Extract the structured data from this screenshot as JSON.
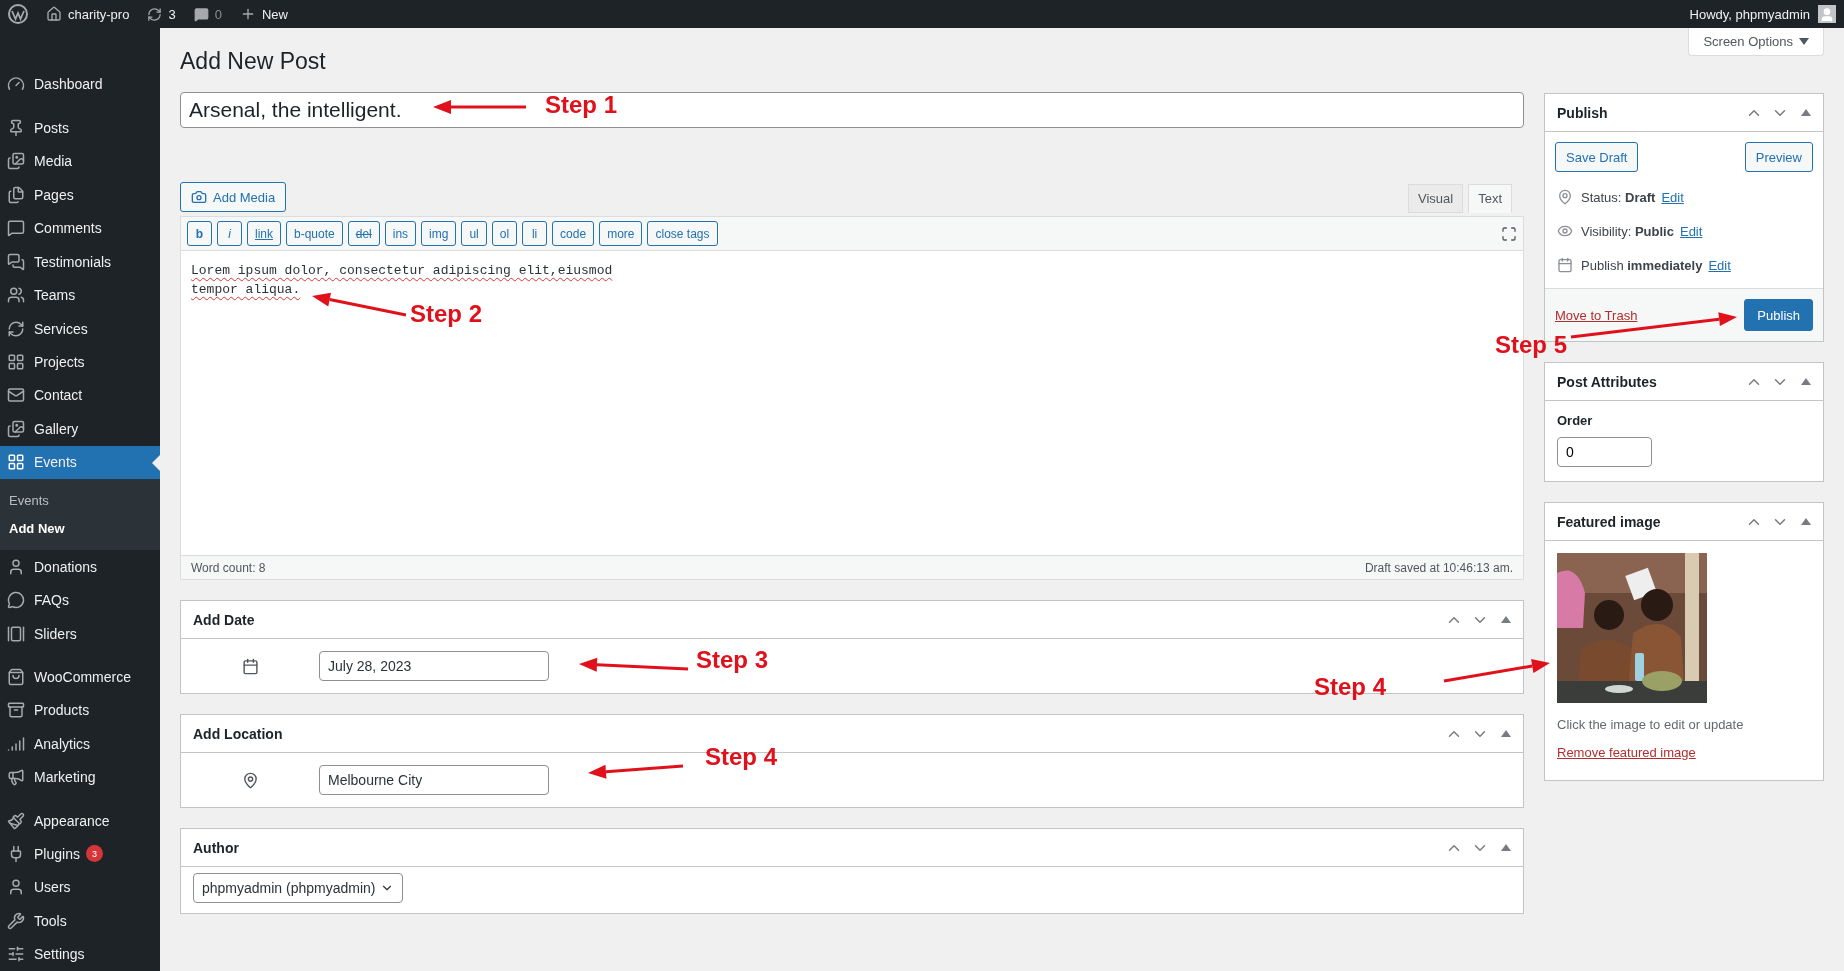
{
  "admin_bar": {
    "site": "charity-pro",
    "updates": "3",
    "comments": "0",
    "new": "New",
    "greeting": "Howdy, phpmyadmin"
  },
  "sidebar": {
    "groups": [
      [
        {
          "label": "Dashboard",
          "selected": false
        }
      ],
      [
        {
          "label": "Posts",
          "selected": false
        },
        {
          "label": "Media",
          "selected": false
        },
        {
          "label": "Pages",
          "selected": false
        },
        {
          "label": "Comments",
          "selected": false
        },
        {
          "label": "Testimonials",
          "selected": false
        },
        {
          "label": "Teams",
          "selected": false
        },
        {
          "label": "Services",
          "selected": false
        },
        {
          "label": "Projects",
          "selected": false
        },
        {
          "label": "Contact",
          "selected": false
        },
        {
          "label": "Gallery",
          "selected": false
        },
        {
          "label": "Events",
          "selected": true,
          "children": [
            {
              "label": "Events",
              "selected": false
            },
            {
              "label": "Add New",
              "selected": true
            }
          ]
        },
        {
          "label": "Donations",
          "selected": false
        },
        {
          "label": "FAQs",
          "selected": false
        },
        {
          "label": "Sliders",
          "selected": false
        }
      ],
      [
        {
          "label": "WooCommerce",
          "selected": false
        },
        {
          "label": "Products",
          "selected": false
        },
        {
          "label": "Analytics",
          "selected": false
        },
        {
          "label": "Marketing",
          "selected": false
        }
      ],
      [
        {
          "label": "Appearance",
          "selected": false
        },
        {
          "label": "Plugins",
          "selected": false,
          "badge": "3"
        },
        {
          "label": "Users",
          "selected": false
        },
        {
          "label": "Tools",
          "selected": false
        },
        {
          "label": "Settings",
          "selected": false
        }
      ]
    ]
  },
  "screen_options": "Screen Options",
  "page_title": "Add New Post",
  "post_title": "Arsenal, the intelligent.",
  "editor": {
    "add_media": "Add Media",
    "tabs": [
      {
        "label": "Visual",
        "selected": false
      },
      {
        "label": "Text",
        "selected": true
      }
    ],
    "quicktags": [
      {
        "label": "b",
        "kind": "bold"
      },
      {
        "label": "i",
        "kind": "italic"
      },
      {
        "label": "link",
        "kind": "link"
      },
      {
        "label": "b-quote",
        "kind": "plain"
      },
      {
        "label": "del",
        "kind": "del"
      },
      {
        "label": "ins",
        "kind": "plain"
      },
      {
        "label": "img",
        "kind": "plain"
      },
      {
        "label": "ul",
        "kind": "plain"
      },
      {
        "label": "ol",
        "kind": "plain"
      },
      {
        "label": "li",
        "kind": "plain"
      },
      {
        "label": "code",
        "kind": "plain"
      },
      {
        "label": "more",
        "kind": "plain"
      },
      {
        "label": "close tags",
        "kind": "plain"
      }
    ],
    "content": [
      "Lorem ipsum dolor, consectetur adipiscing elit,eiusmod",
      "tempor aliqua."
    ],
    "word_count": "Word count: 8",
    "draft_saved": "Draft saved at 10:46:13 am."
  },
  "meta_boxes": [
    {
      "title": "Add Date",
      "kind": "date",
      "value": "July 28, 2023"
    },
    {
      "title": "Add Location",
      "kind": "location",
      "value": "Melbourne City"
    },
    {
      "title": "Author",
      "kind": "select",
      "value": "phpmyadmin (phpmyadmin)"
    }
  ],
  "publish": {
    "title": "Publish",
    "save_draft": "Save Draft",
    "preview": "Preview",
    "settings": [
      {
        "text": "Status: **Draft**",
        "link": "Edit"
      },
      {
        "text": "Visibility: **Public**",
        "link": "Edit"
      },
      {
        "text": "Publish **immediately**",
        "link": "Edit"
      }
    ],
    "trash": "Move to Trash",
    "publish": "Publish"
  },
  "post_attributes": {
    "title": "Post Attributes",
    "label": "Order",
    "value": "0"
  },
  "featured_image": {
    "title": "Featured image",
    "hint": "Click the image to edit or update",
    "remove": "Remove featured image"
  },
  "annotations": [
    {
      "text": "Step 1"
    },
    {
      "text": "Step 2"
    },
    {
      "text": "Step 3"
    },
    {
      "text": "Step 4"
    },
    {
      "text": "Step 4"
    },
    {
      "text": "Step 5"
    }
  ]
}
